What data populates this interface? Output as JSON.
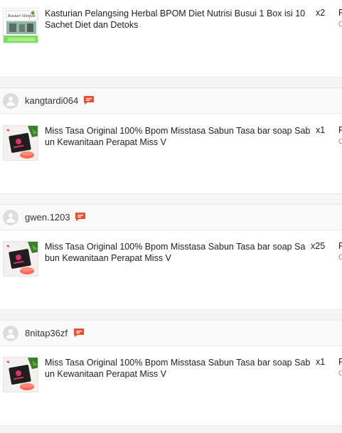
{
  "orders": [
    {
      "username": "",
      "product_name": "Kasturian Pelangsing Herbal BPOM Diet Nutrisi Busui 1 Box isi 10 Sachet Diet dan Detoks",
      "quantity": "x2",
      "price_clip": "F",
      "sub_clip": "C",
      "thumb_text": "Kasturi Slimfast"
    },
    {
      "username": "kangtardi064",
      "product_name": "Miss Tasa Original 100% Bpom Misstasa Sabun Tasa bar soap Sab un Kewanitaan Perapat Miss V",
      "quantity": "x1",
      "price_clip": "F",
      "sub_clip": "C"
    },
    {
      "username": "gwen.1203",
      "product_name": "Miss Tasa Original 100% Bpom Misstasa Sabun Tasa bar soap Sa bun Kewanitaan Perapat Miss V",
      "quantity": "x25",
      "price_clip": "F",
      "sub_clip": "C"
    },
    {
      "username": "8nitap36zf",
      "product_name": "Miss Tasa Original 100% Bpom Misstasa Sabun Tasa bar soap Sab un Kewanitaan Perapat Miss V",
      "quantity": "x1",
      "price_clip": "F",
      "sub_clip": "C"
    }
  ],
  "colors": {
    "chat_icon": "#ee4d2d",
    "accent": "#ee4d2d"
  }
}
